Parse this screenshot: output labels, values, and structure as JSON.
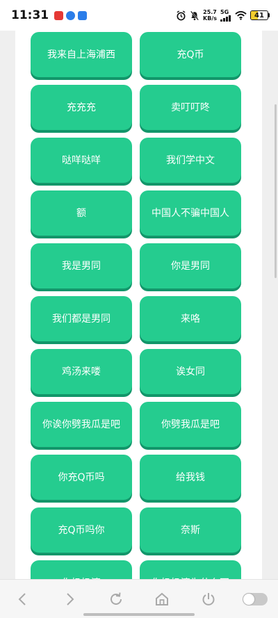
{
  "status_bar": {
    "time": "11:31",
    "speed_value": "25.7",
    "speed_unit": "KB/s",
    "network": "5G",
    "battery": "41",
    "battery_level": 0.41,
    "colors": {
      "app1": "#e53935",
      "app2": "#2b7de9",
      "app3": "#2b7de9"
    }
  },
  "buttons": [
    "我来自上海浦西",
    "充Q币",
    "充充充",
    "卖叮叮咚",
    "哒咩哒咩",
    "我们学中文",
    "额",
    "中国人不骗中国人",
    "我是男同",
    "你是男同",
    "我们都是男同",
    "来咯",
    "鸡汤来喽",
    "诶女同",
    "你诶你劈我瓜是吧",
    "你劈我瓜是吧",
    "你充Q币吗",
    "给我钱",
    "充Q币吗你",
    "奈斯",
    "你奶奶滴",
    "你奶奶滴为什么不"
  ],
  "colors": {
    "button": "#25cc8f",
    "button_shadow": "#12966a"
  },
  "nav": {
    "icons": [
      "back-icon",
      "forward-icon",
      "refresh-icon",
      "home-icon",
      "power-icon",
      "toggle-switch"
    ]
  }
}
